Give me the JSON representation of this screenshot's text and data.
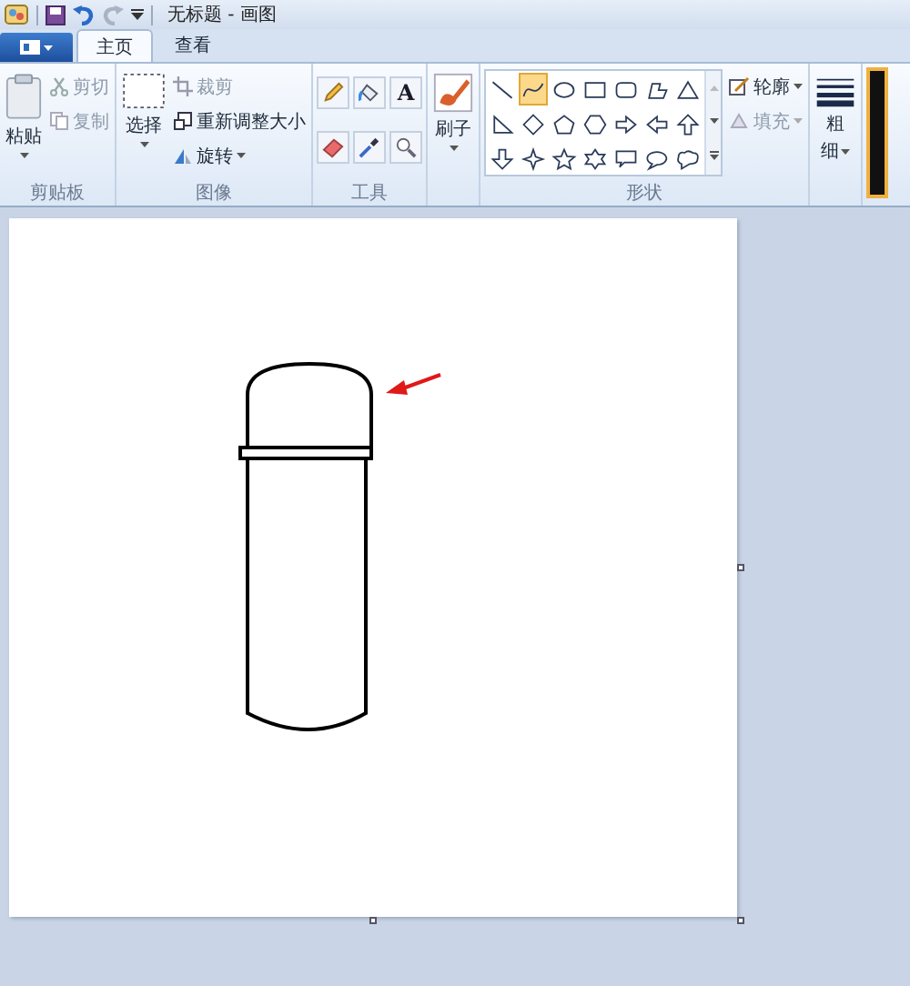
{
  "title_bar": {
    "title": "无标题 - 画图"
  },
  "tabs": [
    {
      "label": "主页",
      "selected": true
    },
    {
      "label": "查看",
      "selected": false
    }
  ],
  "ribbon": {
    "clipboard": {
      "paste": "粘贴",
      "small": [
        {
          "label": "剪切",
          "kind": "cut",
          "disabled": true
        },
        {
          "label": "复制",
          "kind": "copy",
          "disabled": true
        }
      ],
      "group_label": "剪贴板"
    },
    "image": {
      "select": "选择",
      "small": [
        {
          "label": "裁剪",
          "kind": "crop",
          "disabled": true
        },
        {
          "label": "重新调整大小",
          "kind": "resize",
          "disabled": false
        },
        {
          "label": "旋转",
          "kind": "rotate",
          "disabled": false
        }
      ],
      "group_label": "图像"
    },
    "tools": {
      "items": [
        {
          "kind": "pencil"
        },
        {
          "kind": "fill"
        },
        {
          "kind": "text",
          "label": "A"
        },
        {
          "kind": "eraser"
        },
        {
          "kind": "picker"
        },
        {
          "kind": "magnifier"
        }
      ],
      "group_label": "工具"
    },
    "brushes": {
      "label": "刷子"
    },
    "shapes": {
      "items": [
        {
          "kind": "line",
          "selected": false
        },
        {
          "kind": "curve",
          "selected": true
        },
        {
          "kind": "oval",
          "selected": false
        },
        {
          "kind": "rect",
          "selected": false
        },
        {
          "kind": "roundrect",
          "selected": false
        },
        {
          "kind": "polygon",
          "selected": false
        },
        {
          "kind": "triangle",
          "selected": false
        },
        {
          "kind": "righttriangle",
          "selected": false
        },
        {
          "kind": "diamond",
          "selected": false
        },
        {
          "kind": "pentagon",
          "selected": false
        },
        {
          "kind": "hexagon",
          "selected": false
        },
        {
          "kind": "arrowright",
          "selected": false
        },
        {
          "kind": "arrowleft",
          "selected": false
        },
        {
          "kind": "arrowup",
          "selected": false
        },
        {
          "kind": "arrowdown",
          "selected": false
        },
        {
          "kind": "star4",
          "selected": false
        },
        {
          "kind": "star5",
          "selected": false
        },
        {
          "kind": "star6",
          "selected": false
        },
        {
          "kind": "calloutrect",
          "selected": false
        },
        {
          "kind": "calloutoval",
          "selected": false
        },
        {
          "kind": "calloutcloud",
          "selected": false
        }
      ],
      "options": [
        {
          "label": "轮廓",
          "kind": "outline",
          "disabled": false
        },
        {
          "label": "填充",
          "kind": "fill",
          "disabled": true
        }
      ],
      "group_label": "形状"
    },
    "size": {
      "label_top": "粗",
      "label_bottom": "细"
    }
  }
}
